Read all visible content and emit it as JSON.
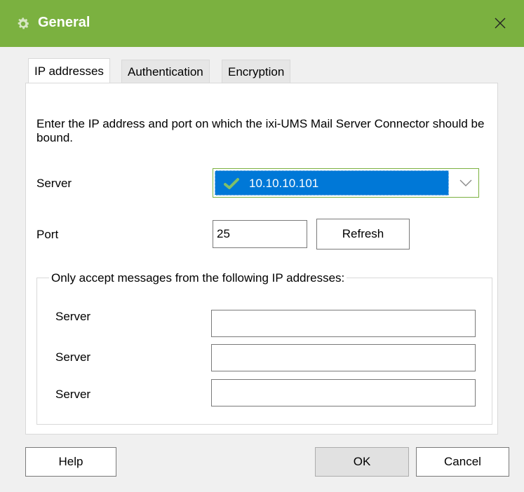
{
  "window": {
    "title": "General",
    "colors": {
      "titlebar": "#7bb140",
      "selection": "#0078d7"
    }
  },
  "tabs": [
    {
      "label": "IP addresses",
      "active": true
    },
    {
      "label": "Authentication",
      "active": false
    },
    {
      "label": "Encryption",
      "active": false
    }
  ],
  "description": "Enter the IP address and port on which the ixi-UMS Mail Server Connector should be bound.",
  "server": {
    "label": "Server",
    "value": "10.10.10.101",
    "icon": "check-icon"
  },
  "port": {
    "label": "Port",
    "value": "25",
    "refresh_label": "Refresh"
  },
  "accept_group": {
    "legend": "Only accept messages from the following IP addresses:",
    "rows": [
      {
        "label": "Server",
        "value": ""
      },
      {
        "label": "Server",
        "value": ""
      },
      {
        "label": "Server",
        "value": ""
      }
    ]
  },
  "buttons": {
    "help": "Help",
    "ok": "OK",
    "cancel": "Cancel"
  }
}
